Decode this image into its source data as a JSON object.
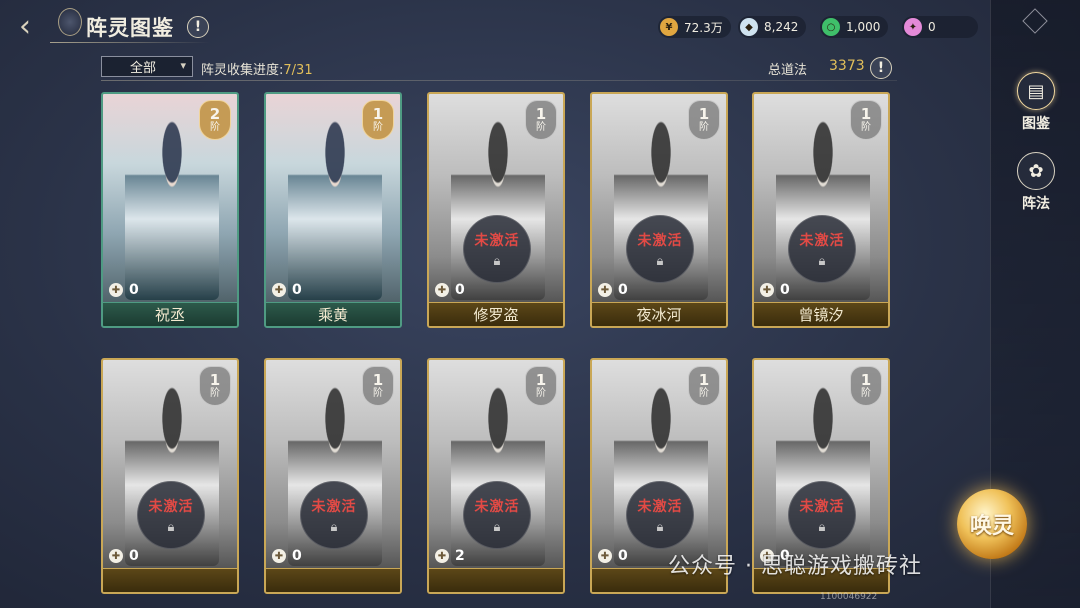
{
  "header": {
    "title": "阵灵图鉴",
    "info_symbol": "!"
  },
  "currencies": [
    {
      "icon": "gold-coin-icon",
      "value": "72.3万",
      "color": "#e0a640"
    },
    {
      "icon": "silver-ingot-icon",
      "value": "8,242",
      "color": "#cfe3f0"
    },
    {
      "icon": "jade-token-icon",
      "value": "1,000",
      "color": "#3fbf6a"
    },
    {
      "icon": "pink-gem-icon",
      "value": "0",
      "color": "#e48ad8"
    }
  ],
  "filter": {
    "selected": "全部",
    "progress_label": "阵灵收集进度:",
    "progress_value": "7/31",
    "total_label": "总道法",
    "total_value": "3373"
  },
  "cards": [
    {
      "name": "祝丞",
      "rank": "2",
      "rank_unit": "阶",
      "fragments": "0",
      "activated": true,
      "status": ""
    },
    {
      "name": "乘黄",
      "rank": "1",
      "rank_unit": "阶",
      "fragments": "0",
      "activated": true,
      "status": ""
    },
    {
      "name": "修罗盗",
      "rank": "1",
      "rank_unit": "阶",
      "fragments": "0",
      "activated": false,
      "status": "未激活"
    },
    {
      "name": "夜冰河",
      "rank": "1",
      "rank_unit": "阶",
      "fragments": "0",
      "activated": false,
      "status": "未激活"
    },
    {
      "name": "曾镜汐",
      "rank": "1",
      "rank_unit": "阶",
      "fragments": "0",
      "activated": false,
      "status": "未激活"
    },
    {
      "name": "",
      "rank": "1",
      "rank_unit": "阶",
      "fragments": "0",
      "activated": false,
      "status": "未激活"
    },
    {
      "name": "",
      "rank": "1",
      "rank_unit": "阶",
      "fragments": "0",
      "activated": false,
      "status": "未激活"
    },
    {
      "name": "",
      "rank": "1",
      "rank_unit": "阶",
      "fragments": "2",
      "activated": false,
      "status": "未激活"
    },
    {
      "name": "",
      "rank": "1",
      "rank_unit": "阶",
      "fragments": "0",
      "activated": false,
      "status": "未激活"
    },
    {
      "name": "",
      "rank": "1",
      "rank_unit": "阶",
      "fragments": "0",
      "activated": false,
      "status": "未激活"
    }
  ],
  "sidebar": {
    "tabs": [
      {
        "label": "图鉴",
        "icon": "card-book-icon",
        "active": true
      },
      {
        "label": "阵法",
        "icon": "formation-flower-icon",
        "active": false
      }
    ]
  },
  "summon": {
    "label": "唤灵"
  },
  "watermark": "公众号 · 思聪游戏搬砖社",
  "footer": {
    "id": "1100046922"
  }
}
